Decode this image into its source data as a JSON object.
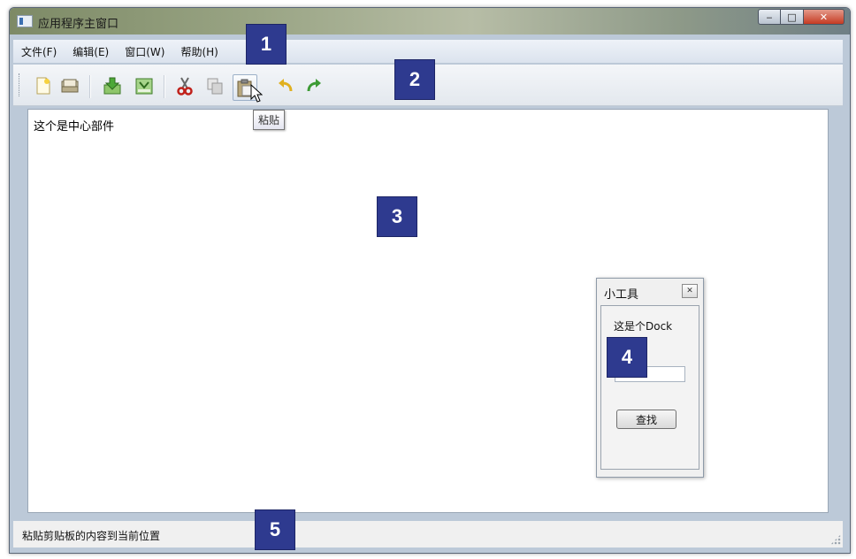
{
  "window": {
    "title": "应用程序主窗口",
    "controls": {
      "minimize": "‒",
      "maximize": "□",
      "close": "✕"
    }
  },
  "menubar": {
    "items": [
      {
        "label": "文件(F)"
      },
      {
        "label": "编辑(E)"
      },
      {
        "label": "窗口(W)"
      },
      {
        "label": "帮助(H)"
      }
    ]
  },
  "toolbar": {
    "buttons": [
      {
        "icon": "new-file-icon"
      },
      {
        "icon": "open-folder-icon"
      },
      {
        "icon": "save-icon"
      },
      {
        "icon": "save-as-icon"
      },
      {
        "icon": "cut-icon"
      },
      {
        "icon": "copy-icon"
      },
      {
        "icon": "paste-icon",
        "active": true
      },
      {
        "icon": "undo-icon"
      },
      {
        "icon": "redo-icon"
      }
    ],
    "tooltip": "粘贴"
  },
  "central": {
    "text": "这个是中心部件"
  },
  "dock": {
    "title": "小工具",
    "label": "这是个Dock",
    "input_value": "",
    "button_label": "查找"
  },
  "statusbar": {
    "text": "粘贴剪贴板的内容到当前位置"
  },
  "badges": [
    "1",
    "2",
    "3",
    "4",
    "5"
  ],
  "colors": {
    "badge": "#2e3a8f",
    "menubar": "#dbe3ee"
  }
}
